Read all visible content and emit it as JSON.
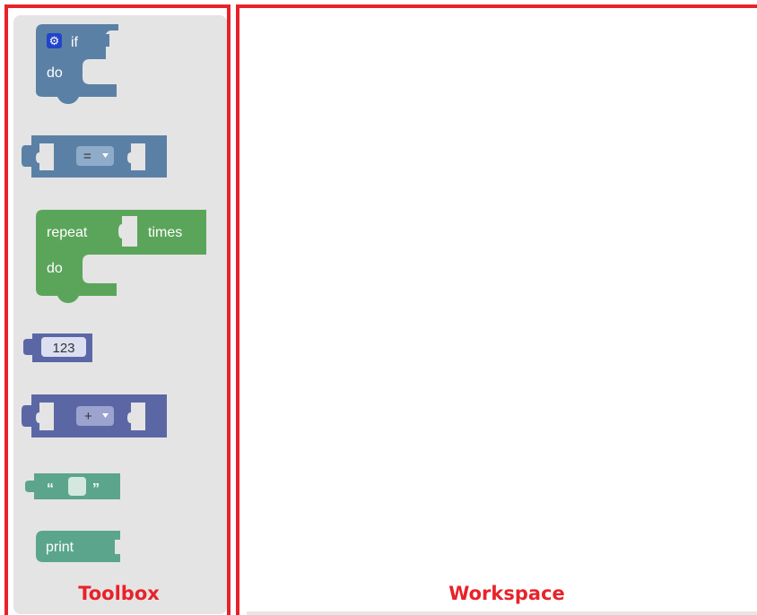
{
  "panels": {
    "toolbox_label": "Toolbox",
    "workspace_label": "Workspace"
  },
  "blocks": {
    "if_block": {
      "keyword_if": "if",
      "keyword_do": "do",
      "icon": "gear-icon",
      "color": "#5b80a5"
    },
    "compare_block": {
      "operator": "=",
      "dropdown_icon": "dropdown-arrow-icon",
      "color": "#5b80a5"
    },
    "repeat_block": {
      "keyword_repeat": "repeat",
      "keyword_times": "times",
      "keyword_do": "do",
      "color": "#5ba55b"
    },
    "number_block": {
      "value": "123",
      "color": "#5b67a5"
    },
    "arithmetic_block": {
      "operator": "+",
      "dropdown_icon": "dropdown-arrow-icon",
      "color": "#5b67a5"
    },
    "text_block": {
      "open_quote": "“",
      "close_quote": "”",
      "color": "#5ba58c"
    },
    "print_block": {
      "keyword_print": "print",
      "color": "#5ba58c"
    }
  },
  "colors": {
    "highlight_red": "#e8222a",
    "toolbox_bg": "#e4e4e4"
  }
}
